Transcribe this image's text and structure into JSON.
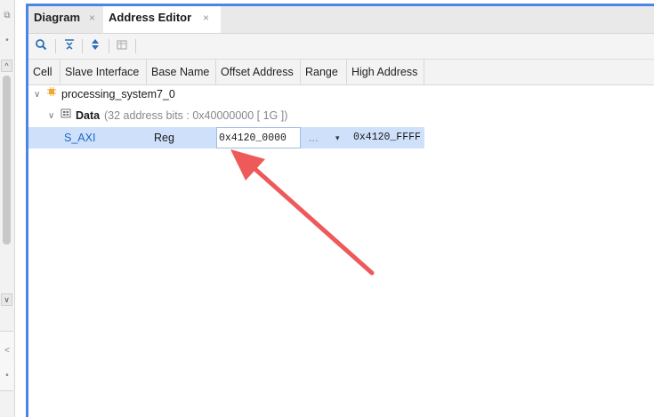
{
  "tabs": [
    {
      "label": "Diagram",
      "close": "×"
    },
    {
      "label": "Address Editor",
      "close": "×"
    }
  ],
  "toolbar": {
    "icons": [
      "search-icon",
      "collapse-all-icon",
      "expand-all-icon",
      "auto-assign-icon"
    ],
    "glyphs": [
      "🔍",
      "≚",
      "⇕",
      "▦"
    ]
  },
  "table": {
    "columns": [
      "Cell",
      "Slave Interface",
      "Base Name",
      "Offset Address",
      "Range",
      "High Address"
    ],
    "rows": {
      "processor": {
        "caret": "∨",
        "label": "processing_system7_0"
      },
      "data": {
        "caret": "∨",
        "label": "Data",
        "detail": "(32 address bits : 0x40000000 [ 1G ])"
      },
      "selected": {
        "slave_interface": "S_AXI",
        "base_name": "Reg",
        "offset_value": "0x4120_0000",
        "range_value": "...",
        "range_arrow": "▾",
        "high_address": "0x4120_FFFF"
      }
    }
  },
  "left_strip": {
    "up": "^",
    "down": "∨",
    "left": "<"
  },
  "colors": {
    "accent": "#4a86e8",
    "selection": "#cfe0fa",
    "annotation_arrow": "#ee5a5a",
    "link": "#1f66c8"
  }
}
